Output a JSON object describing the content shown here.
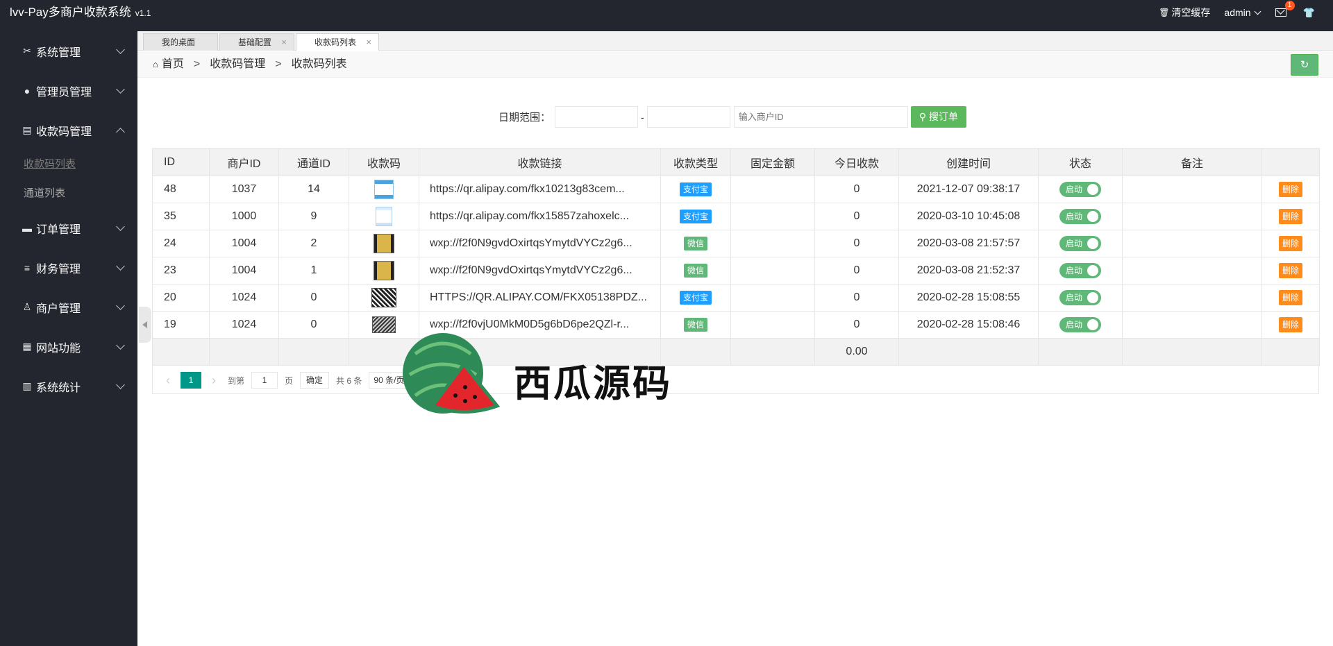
{
  "app": {
    "title": "lvv-Pay多商户收款系统",
    "version": "v1.1"
  },
  "topbar": {
    "clear_cache": "清空缓存",
    "user": "admin",
    "mail_count": "1"
  },
  "sidebar": {
    "items": [
      {
        "label": "系统管理",
        "icon": "wrench-icon"
      },
      {
        "label": "管理员管理",
        "icon": "user-icon"
      },
      {
        "label": "收款码管理",
        "icon": "doc-icon",
        "expanded": true,
        "children": [
          {
            "label": "收款码列表",
            "active": true
          },
          {
            "label": "通道列表"
          }
        ]
      },
      {
        "label": "订单管理",
        "icon": "card-icon"
      },
      {
        "label": "财务管理",
        "icon": "database-icon"
      },
      {
        "label": "商户管理",
        "icon": "users-icon"
      },
      {
        "label": "网站功能",
        "icon": "window-icon"
      },
      {
        "label": "系统统计",
        "icon": "chart-icon"
      }
    ]
  },
  "tabs": [
    {
      "label": "我的桌面",
      "closable": false
    },
    {
      "label": "基础配置",
      "closable": true
    },
    {
      "label": "收款码列表",
      "closable": true,
      "active": true
    }
  ],
  "breadcrumb": {
    "home": "首页",
    "sep": ">",
    "level1": "收款码管理",
    "level2": "收款码列表"
  },
  "search": {
    "date_label": "日期范围：",
    "date_sep": "-",
    "merchant_placeholder": "输入商户ID",
    "button": "搜订单"
  },
  "table": {
    "headers": [
      "ID",
      "商户ID",
      "通道ID",
      "收款码",
      "收款链接",
      "收款类型",
      "固定金额",
      "今日收款",
      "创建时间",
      "状态",
      "备注",
      ""
    ],
    "rows": [
      {
        "id": "48",
        "merchant": "1037",
        "channel": "14",
        "qr": "blue",
        "link": "https://qr.alipay.com/fkx10213g83cem...",
        "type": "支付宝",
        "type_color": "blue",
        "fixed": "",
        "today": "0",
        "created": "2021-12-07 09:38:17",
        "status": "启动",
        "remark": "",
        "action": "删除"
      },
      {
        "id": "35",
        "merchant": "1000",
        "channel": "9",
        "qr": "blue2",
        "link": "https://qr.alipay.com/fkx15857zahoxelc...",
        "type": "支付宝",
        "type_color": "blue",
        "fixed": "",
        "today": "0",
        "created": "2020-03-10 10:45:08",
        "status": "启动",
        "remark": "",
        "action": "删除"
      },
      {
        "id": "24",
        "merchant": "1004",
        "channel": "2",
        "qr": "yel",
        "link": "wxp://f2f0N9gvdOxirtqsYmytdVYCz2g6...",
        "type": "微信",
        "type_color": "green",
        "fixed": "",
        "today": "0",
        "created": "2020-03-08 21:57:57",
        "status": "启动",
        "remark": "",
        "action": "删除"
      },
      {
        "id": "23",
        "merchant": "1004",
        "channel": "1",
        "qr": "yel",
        "link": "wxp://f2f0N9gvdOxirtqsYmytdVYCz2g6...",
        "type": "微信",
        "type_color": "green",
        "fixed": "",
        "today": "0",
        "created": "2020-03-08 21:52:37",
        "status": "启动",
        "remark": "",
        "action": "删除"
      },
      {
        "id": "20",
        "merchant": "1024",
        "channel": "0",
        "qr": "blk",
        "link": "HTTPS://QR.ALIPAY.COM/FKX05138PDZ...",
        "type": "支付宝",
        "type_color": "blue",
        "fixed": "",
        "today": "0",
        "created": "2020-02-28 15:08:55",
        "status": "启动",
        "remark": "",
        "action": "删除"
      },
      {
        "id": "19",
        "merchant": "1024",
        "channel": "0",
        "qr": "blk2",
        "link": "wxp://f2f0vjU0MkM0D5g6bD6pe2QZl-r...",
        "type": "微信",
        "type_color": "green",
        "fixed": "",
        "today": "0",
        "created": "2020-02-28 15:08:46",
        "status": "启动",
        "remark": "",
        "action": "删除"
      }
    ],
    "total_today": "0.00"
  },
  "pager": {
    "current": "1",
    "goto_label": "到第",
    "goto_value": "1",
    "page_unit": "页",
    "confirm": "确定",
    "total": "共 6 条",
    "limit": "90 条/页"
  },
  "watermark": {
    "text": "西瓜源码"
  }
}
